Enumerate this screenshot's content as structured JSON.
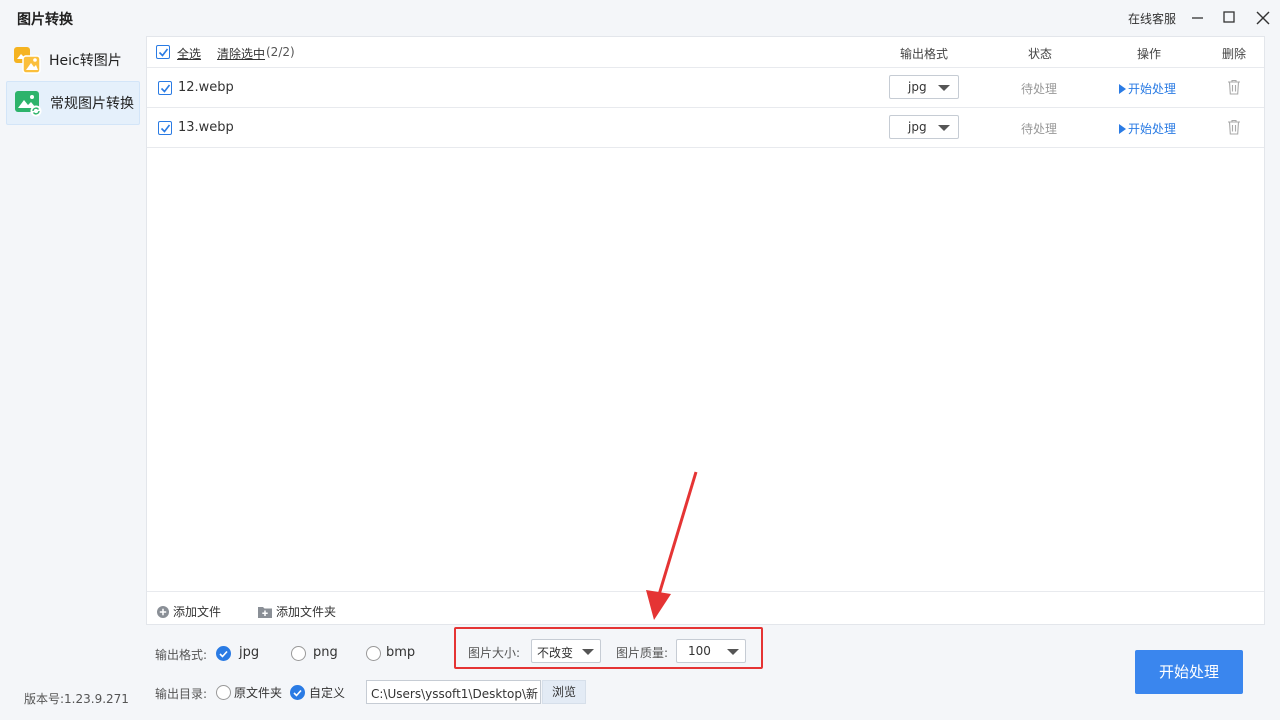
{
  "window": {
    "title": "图片转换",
    "support_label": "在线客服"
  },
  "sidebar": {
    "items": [
      {
        "label": "Heic转图片",
        "icon": "heic-image-icon",
        "active": false
      },
      {
        "label": "常规图片转换",
        "icon": "image-convert-icon",
        "active": true
      }
    ],
    "version": "版本号:1.23.9.271"
  },
  "list": {
    "select_all_label": "全选",
    "clear_selection_label": "清除选中",
    "selection_count": "(2/2)",
    "columns": {
      "format": "输出格式",
      "status": "状态",
      "action": "操作",
      "delete": "删除"
    },
    "rows": [
      {
        "filename": "12.webp",
        "format": "jpg",
        "status": "待处理",
        "action": "开始处理",
        "checked": true
      },
      {
        "filename": "13.webp",
        "format": "jpg",
        "status": "待处理",
        "action": "开始处理",
        "checked": true
      }
    ]
  },
  "footer": {
    "add_file_label": "添加文件",
    "add_folder_label": "添加文件夹"
  },
  "options": {
    "output_format_label": "输出格式:",
    "formats": [
      {
        "label": "jpg",
        "checked": true
      },
      {
        "label": "png",
        "checked": false
      },
      {
        "label": "bmp",
        "checked": false
      }
    ],
    "image_size_label": "图片大小:",
    "image_size_value": "不改变",
    "image_quality_label": "图片质量:",
    "image_quality_value": "100",
    "output_dir_label": "输出目录:",
    "dir_options": [
      {
        "label": "原文件夹",
        "checked": false
      },
      {
        "label": "自定义",
        "checked": true
      }
    ],
    "path_value": "C:\\Users\\yssoft1\\Desktop\\新",
    "browse_label": "浏览",
    "start_button_label": "开始处理"
  },
  "colors": {
    "accent": "#3a86ee",
    "link": "#2a7be4",
    "highlight": "#e53434"
  }
}
